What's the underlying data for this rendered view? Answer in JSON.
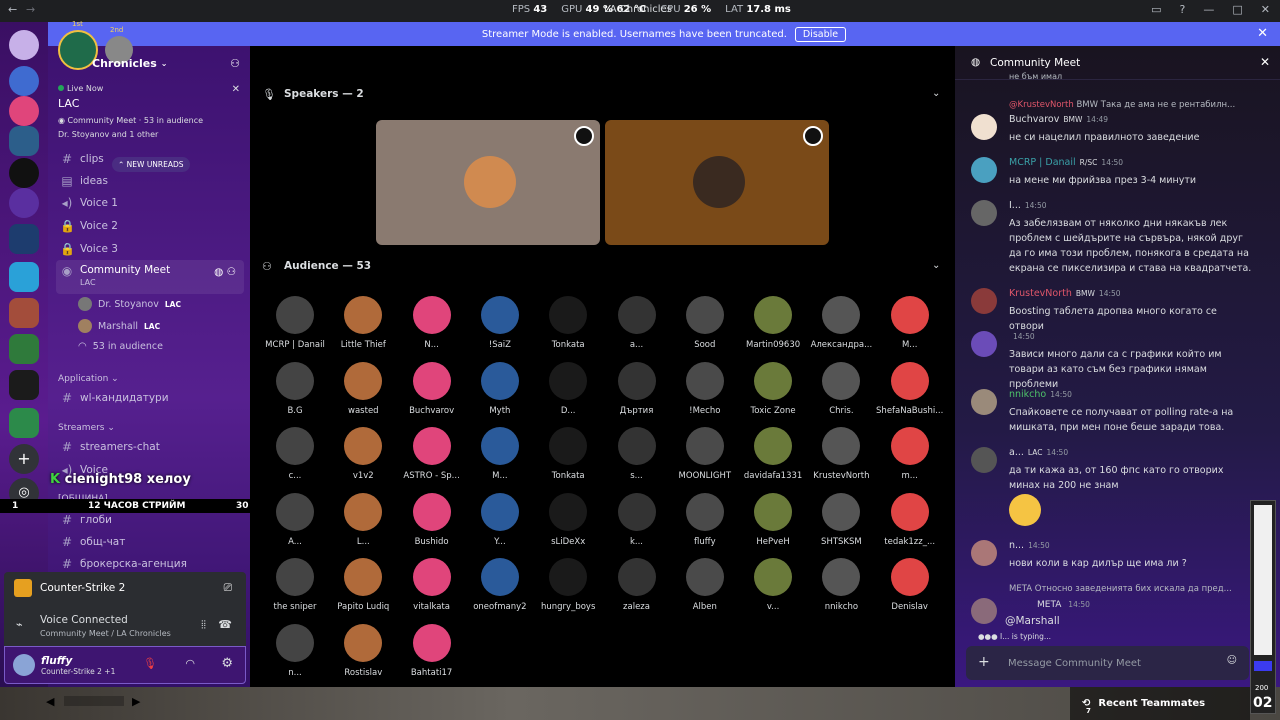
{
  "titlebar": {
    "app_title": "LA Chronicles",
    "fps_label": "FPS",
    "fps": "43",
    "gpu_label": "GPU",
    "gpu": "49 % 62 °C",
    "cpu_label": "CPU",
    "cpu": "26 %",
    "lat_label": "LAT",
    "lat": "17.8 ms"
  },
  "banner": {
    "text": "Streamer Mode is enabled. Usernames have been truncated.",
    "button": "Disable"
  },
  "server": {
    "name": "Chronicles",
    "badge_1": "1st",
    "badge_2": "2nd"
  },
  "live": {
    "status": "Live Now",
    "title": "LAC",
    "channel": "Community Meet",
    "audience": "53 in audience",
    "participants": "Dr. Stoyanov and 1 other"
  },
  "new_unreads": "NEW UNREADS",
  "channels": [
    {
      "label": "clips",
      "icon": "hash"
    },
    {
      "label": "ideas",
      "icon": "forum"
    },
    {
      "label": "Voice 1",
      "icon": "speaker"
    },
    {
      "label": "Voice 2",
      "icon": "lock"
    },
    {
      "label": "Voice 3",
      "icon": "lock"
    }
  ],
  "stage_channel": {
    "label": "Community Meet",
    "sub": "LAC",
    "speakers": [
      {
        "name": "Dr. Stoyanov",
        "tag": "LAC"
      },
      {
        "name": "Marshall",
        "tag": "LAC"
      }
    ],
    "audience": "53 in audience"
  },
  "categories": {
    "application": "Application",
    "application_channel": "wl-кандидатури",
    "streamers": "Streamers",
    "streamers_chat": "streamers-chat",
    "voice": "Voice",
    "community": "[ОБЩИНА]",
    "globi": "глоби",
    "obsht_chat": "общ-чат",
    "broker": "брокерска-агенция"
  },
  "overlay": {
    "user": "cienight98",
    "msg": "хелоу",
    "left": "1",
    "center": "12 ЧАСОВ СТРИЙМ",
    "right": "30"
  },
  "activity": {
    "game": "Counter-Strike 2"
  },
  "voice": {
    "status": "Voice Connected",
    "location": "Community Meet / LA Chronicles"
  },
  "user": {
    "name": "fluffy",
    "game": "Counter-Strike 2 +1"
  },
  "stage": {
    "speakers_title": "Speakers — 2",
    "audience_title": "Audience — 53",
    "audience": [
      "MCRP | Danail",
      "Little Thief",
      "N...",
      "!SaiZ",
      "Tonkata",
      "a...",
      "Sood",
      "Martin09630",
      "Александра...",
      "M...",
      "B.G",
      "wasted",
      "Buchvarov",
      "Myth",
      "D...",
      "Дъртия",
      "!Mecho",
      "Toxic Zone",
      "Chris.",
      "ShefaNaBushi...",
      "c...",
      "v1v2",
      "ASTRO - Sp...",
      "M...",
      "Tonkata",
      "s...",
      "MOONLIGHT",
      "davidafa1331",
      "KrustevNorth",
      "m...",
      "A...",
      "L...",
      "Bushido",
      "Y...",
      "sLiDeXx",
      "k...",
      "fluffy",
      "HePvеH",
      "SHTSKSM",
      "tedak1zz_...",
      "the sniper",
      "Papito Ludiq",
      "vitalkata",
      "oneofmany2",
      "hungry_boys",
      "zaleza",
      "Alben",
      "v...",
      "nnikcho",
      "Denislav",
      "n...",
      "Rostislav",
      "Bahtati17"
    ]
  },
  "chat": {
    "title": "Community Meet",
    "top_partial": "не бъм имал",
    "messages": [
      {
        "reply_user": "@KrustevNorth",
        "reply_tag": "BMW",
        "reply_text": "Така де ама не е рентабилн...",
        "user": "Buchvarov",
        "tag": "BMW",
        "time": "14:49",
        "text": "не си нацелил правилното заведение",
        "color": "#dbdee1"
      },
      {
        "user": "MCRP | Danail",
        "tag": "R/SC",
        "time": "14:50",
        "text": "на мене ми фрийзва през 3-4 минути",
        "color": "#3aa0a7"
      },
      {
        "user": "I...",
        "tag": "",
        "time": "14:50",
        "text": "Аз забелязвам от няколко дни някакъв лек проблем с шейдърите на сървъра, някой друг да го има този проблем, понякога в средата на екрана се пикселизира и става на квадратчета.",
        "color": "#dbdee1"
      },
      {
        "user": "KrustevNorth",
        "tag": "BMW",
        "time": "14:50",
        "text": "Boosting таблета дропва много когато се отвори",
        "color": "#e0566a"
      },
      {
        "user": "",
        "tag": "",
        "time": "14:50",
        "text": "Зависи много дали са с графики който им товари аз като съм без графики нямам проблеми",
        "color": "#6b4cb8"
      },
      {
        "user": "nnikcho",
        "tag": "",
        "time": "14:50",
        "text": "Спайковете се получават от polling rate-а на мишката, при мен поне беше заради това.",
        "color": "#4ec26a"
      },
      {
        "user": "a...",
        "tag": "LAC",
        "time": "14:50",
        "text": "да ти кажа аз, от 160 фпс като го отворих минах на 200 не знам",
        "color": "#dbdee1"
      },
      {
        "user": "n...",
        "tag": "",
        "time": "14:50",
        "text": "нови коли в кар дилър ще има ли ?",
        "color": "#dbdee1"
      },
      {
        "reply_user": "",
        "reply_tag": "META",
        "reply_text": "Относно заведенията бих искала да пред...",
        "user": "",
        "tag": "META",
        "time": "14:50",
        "text": "@Marshall",
        "color": "#dbdee1"
      }
    ],
    "typing": "I... is typing...",
    "placeholder": "Message Community Meet"
  },
  "bottom": {
    "recent": "Recent Teammates",
    "hud_top": "200",
    "hud_num": "02",
    "count": "7"
  }
}
